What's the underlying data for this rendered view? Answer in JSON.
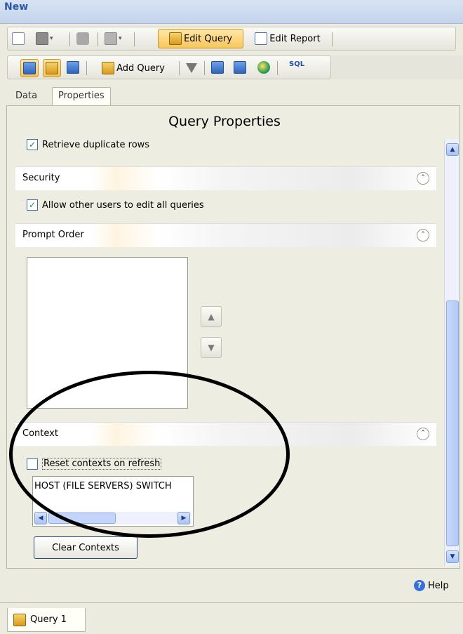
{
  "window": {
    "title": "New"
  },
  "toolbar1": {
    "edit_query": "Edit Query",
    "edit_report": "Edit Report"
  },
  "toolbar2": {
    "add_query": "Add Query",
    "sql": "SQL"
  },
  "tabs": [
    {
      "label": "Data",
      "selected": false
    },
    {
      "label": "Properties",
      "selected": true
    }
  ],
  "panel": {
    "title": "Query Properties",
    "retrieve_duplicate_rows": {
      "label": "Retrieve duplicate rows",
      "checked": true
    },
    "security": {
      "label": "Security",
      "allow_edit": {
        "label": "Allow other users to edit all queries",
        "checked": true
      }
    },
    "prompt_order": {
      "label": "Prompt Order"
    },
    "context": {
      "label": "Context",
      "reset": {
        "label": "Reset contexts on refresh",
        "checked": false
      },
      "list_item": "HOST (FILE SERVERS) SWITCH",
      "clear_button": "Clear Contexts"
    }
  },
  "footer": {
    "help": "Help"
  },
  "query_tab": {
    "label": "Query 1"
  },
  "colors": {
    "accent_blue": "#2b58a8",
    "active_button": "#f8c65b",
    "panel_bg": "#eeede2"
  }
}
